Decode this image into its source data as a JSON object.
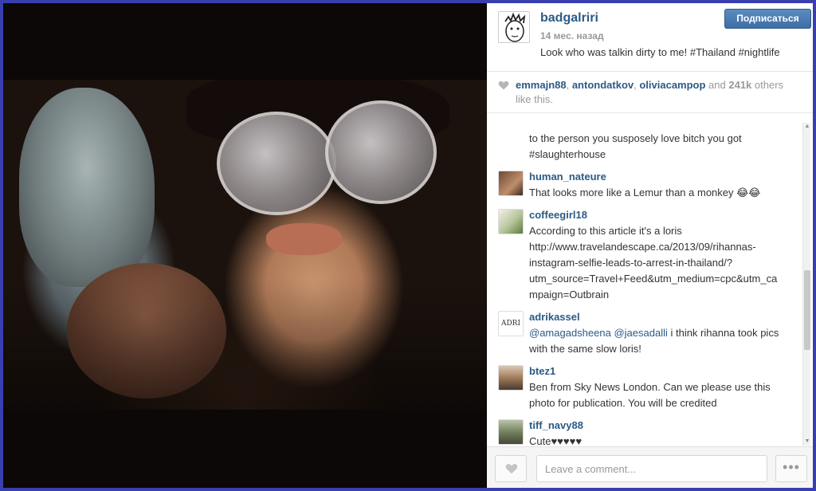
{
  "post": {
    "username": "badgalriri",
    "timestamp": "14 мес. назад",
    "caption": "Look who was talkin dirty to me! #Thailand #nightlife",
    "follow_label": "Подписаться"
  },
  "likes": {
    "users": [
      "emmajn88",
      "antondatkov",
      "oliviacampop"
    ],
    "sep1": ", ",
    "sep2": ", ",
    "and_text": " and ",
    "count": "241k",
    "suffix": " others like this."
  },
  "comments": [
    {
      "username": "",
      "text": "to the person you susposely love bitch you got #slaughterhouse"
    },
    {
      "username": "human_nateure",
      "text": "That looks more like a Lemur than a monkey 😂😂"
    },
    {
      "username": "coffeegirl18",
      "text": "According to this article it's a loris http://www.travelandescape.ca/2013/09/rihannas-instagram-selfie-leads-to-arrest-in-thailand/?utm_source=Travel+Feed&utm_medium=cpc&utm_campaign=Outbrain"
    },
    {
      "username": "adrikassel",
      "mention1": "@amagadsheena",
      "mention2": "@jaesadalli",
      "text": " i think rihanna took pics with the same slow loris!"
    },
    {
      "username": "btez1",
      "text": "Ben from Sky News London. Can we please use this photo for publication. You will be credited"
    },
    {
      "username": "tiff_navy88",
      "text": "Cute♥♥♥♥♥"
    }
  ],
  "avatar_badge": "ADRI",
  "footer": {
    "comment_placeholder": "Leave a comment...",
    "more_label": "•••"
  },
  "colors": {
    "link": "#2c5a85",
    "follow_button": "#3e6ea5",
    "page_border": "#3a3fb0"
  }
}
